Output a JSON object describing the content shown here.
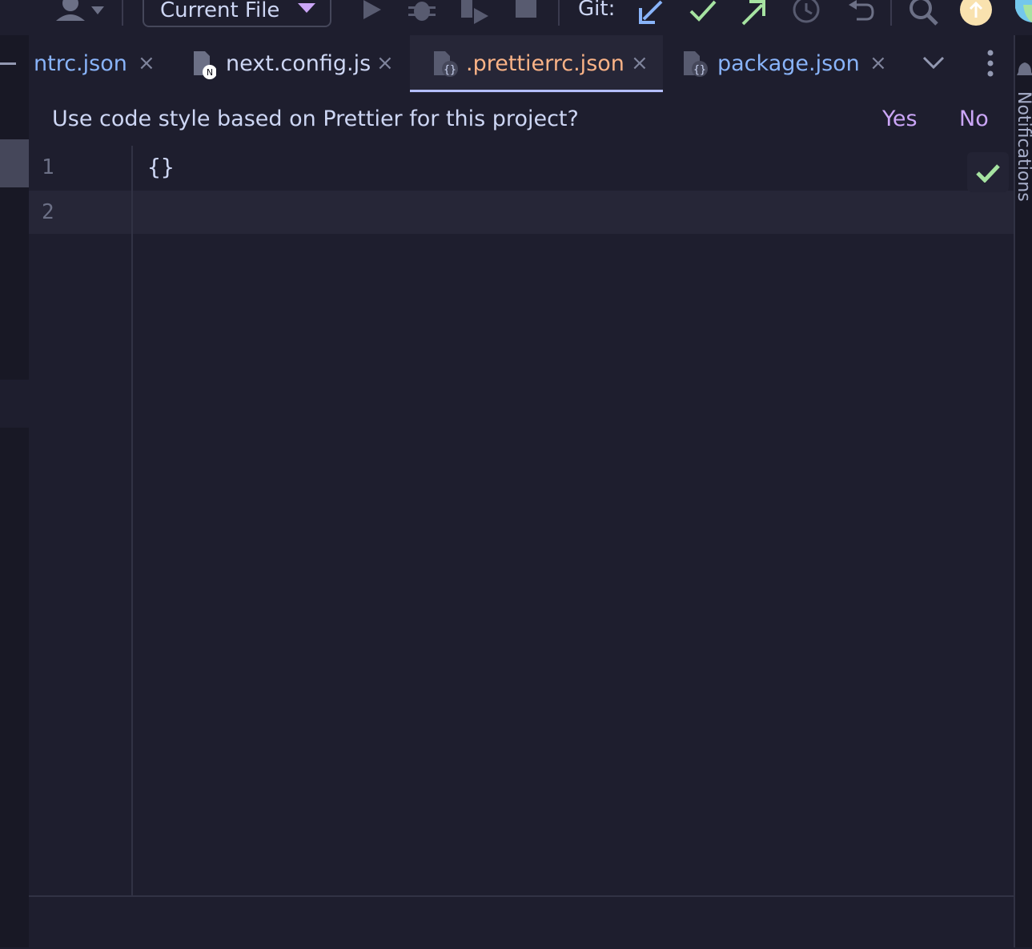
{
  "toolbar": {
    "run_config_label": "Current File",
    "git_label": "Git:"
  },
  "tabs": [
    {
      "label": "ntrc.json",
      "active": false
    },
    {
      "label": "next.config.js",
      "active": false
    },
    {
      "label": ".prettierrc.json",
      "active": true
    },
    {
      "label": "package.json",
      "active": false
    }
  ],
  "tab_close_glyph": "×",
  "banner": {
    "text": "Use code style based on Prettier for this project?",
    "yes_label": "Yes",
    "no_label": "No"
  },
  "editor": {
    "lines": [
      {
        "number": "1",
        "text": "{}"
      },
      {
        "number": "2",
        "text": ""
      }
    ]
  },
  "right_panel": {
    "notifications_label": "Notifications"
  },
  "colors": {
    "background": "#1e1e2e",
    "active_tab_text": "#fab387",
    "tab_text": "#89b4fa",
    "link": "#cba6f7",
    "check": "#a6e3a1"
  }
}
